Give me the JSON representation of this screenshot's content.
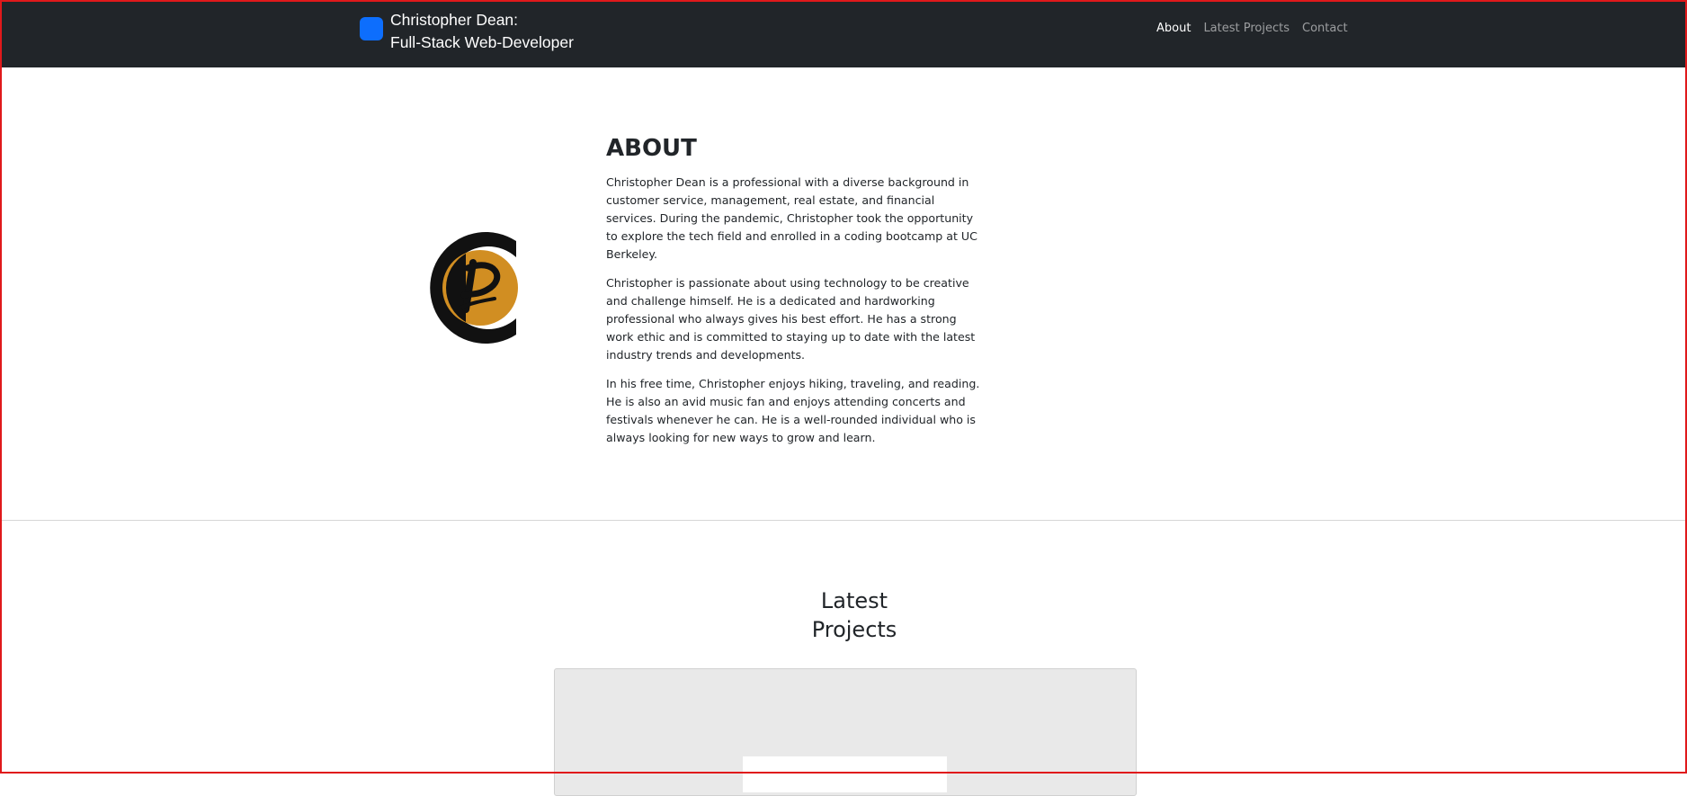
{
  "nav": {
    "brand_line1": "Christopher Dean:",
    "brand_line2": "Full-Stack Web-Developer",
    "links": [
      {
        "label": "About",
        "active": true
      },
      {
        "label": "Latest Projects",
        "active": false
      },
      {
        "label": "Contact",
        "active": false
      }
    ]
  },
  "about": {
    "title": "ABOUT",
    "paragraphs": [
      "Christopher Dean is a professional with a diverse background in customer service, management, real estate, and financial services. During the pandemic, Christopher took the opportunity to explore the tech field and enrolled in a coding bootcamp at UC Berkeley.",
      "Christopher is passionate about using technology to be creative and challenge himself. He is a dedicated and hardworking professional who always gives his best effort. He has a strong work ethic and is committed to staying up to date with the latest industry trends and developments.",
      "In his free time, Christopher enjoys hiking, traveling, and reading. He is also an avid music fan and enjoys attending concerts and festivals whenever he can. He is a well-rounded individual who is always looking for new ways to grow and learn."
    ]
  },
  "projects": {
    "title_line1": "Latest",
    "title_line2": "Projects"
  },
  "colors": {
    "navbar": "#212529",
    "brand_logo": "#0d6efd",
    "logo_gold": "#d18e22",
    "frame": "#e0191b"
  }
}
